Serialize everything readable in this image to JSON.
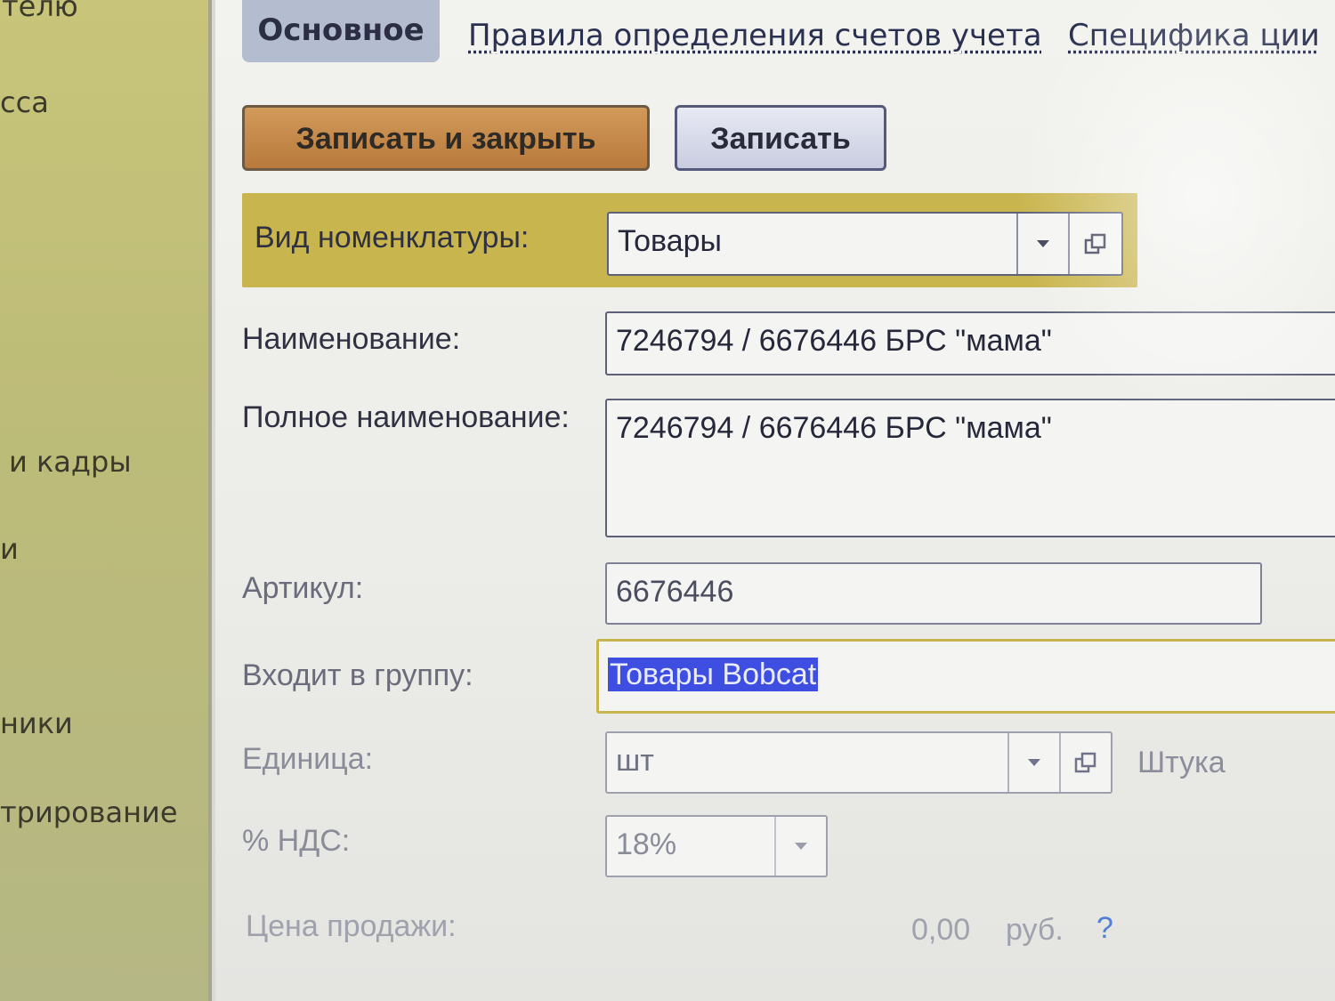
{
  "sidebar": {
    "items": [
      {
        "label": "телю"
      },
      {
        "label": "сса"
      },
      {
        "label": "и кадры"
      },
      {
        "label": "и"
      },
      {
        "label": "ники"
      },
      {
        "label": "трирование"
      }
    ]
  },
  "tabs": {
    "main": "Основное",
    "accounts": "Правила определения счетов учета",
    "spec": "Специфика  ции"
  },
  "toolbar": {
    "save_close_label": "Записать и закрыть",
    "save_label": "Записать"
  },
  "form": {
    "kind": {
      "label": "Вид номенклатуры:",
      "value": "Товары"
    },
    "name": {
      "label": "Наименование:",
      "value": "7246794 / 6676446 БРС \"мама\""
    },
    "full_name": {
      "label": "Полное наименование:",
      "value": "7246794 / 6676446 БРС \"мама\""
    },
    "article": {
      "label": "Артикул:",
      "value": "6676446"
    },
    "group": {
      "label": "Входит в группу:",
      "value": "Товары Bobcat"
    },
    "unit": {
      "label": "Единица:",
      "value": "шт",
      "full": "Штука"
    },
    "vat": {
      "label": "% НДС:",
      "value": "18%"
    },
    "price": {
      "label": "Цена продажи:",
      "value": "0,00",
      "currency": "руб.",
      "help": "?"
    }
  }
}
